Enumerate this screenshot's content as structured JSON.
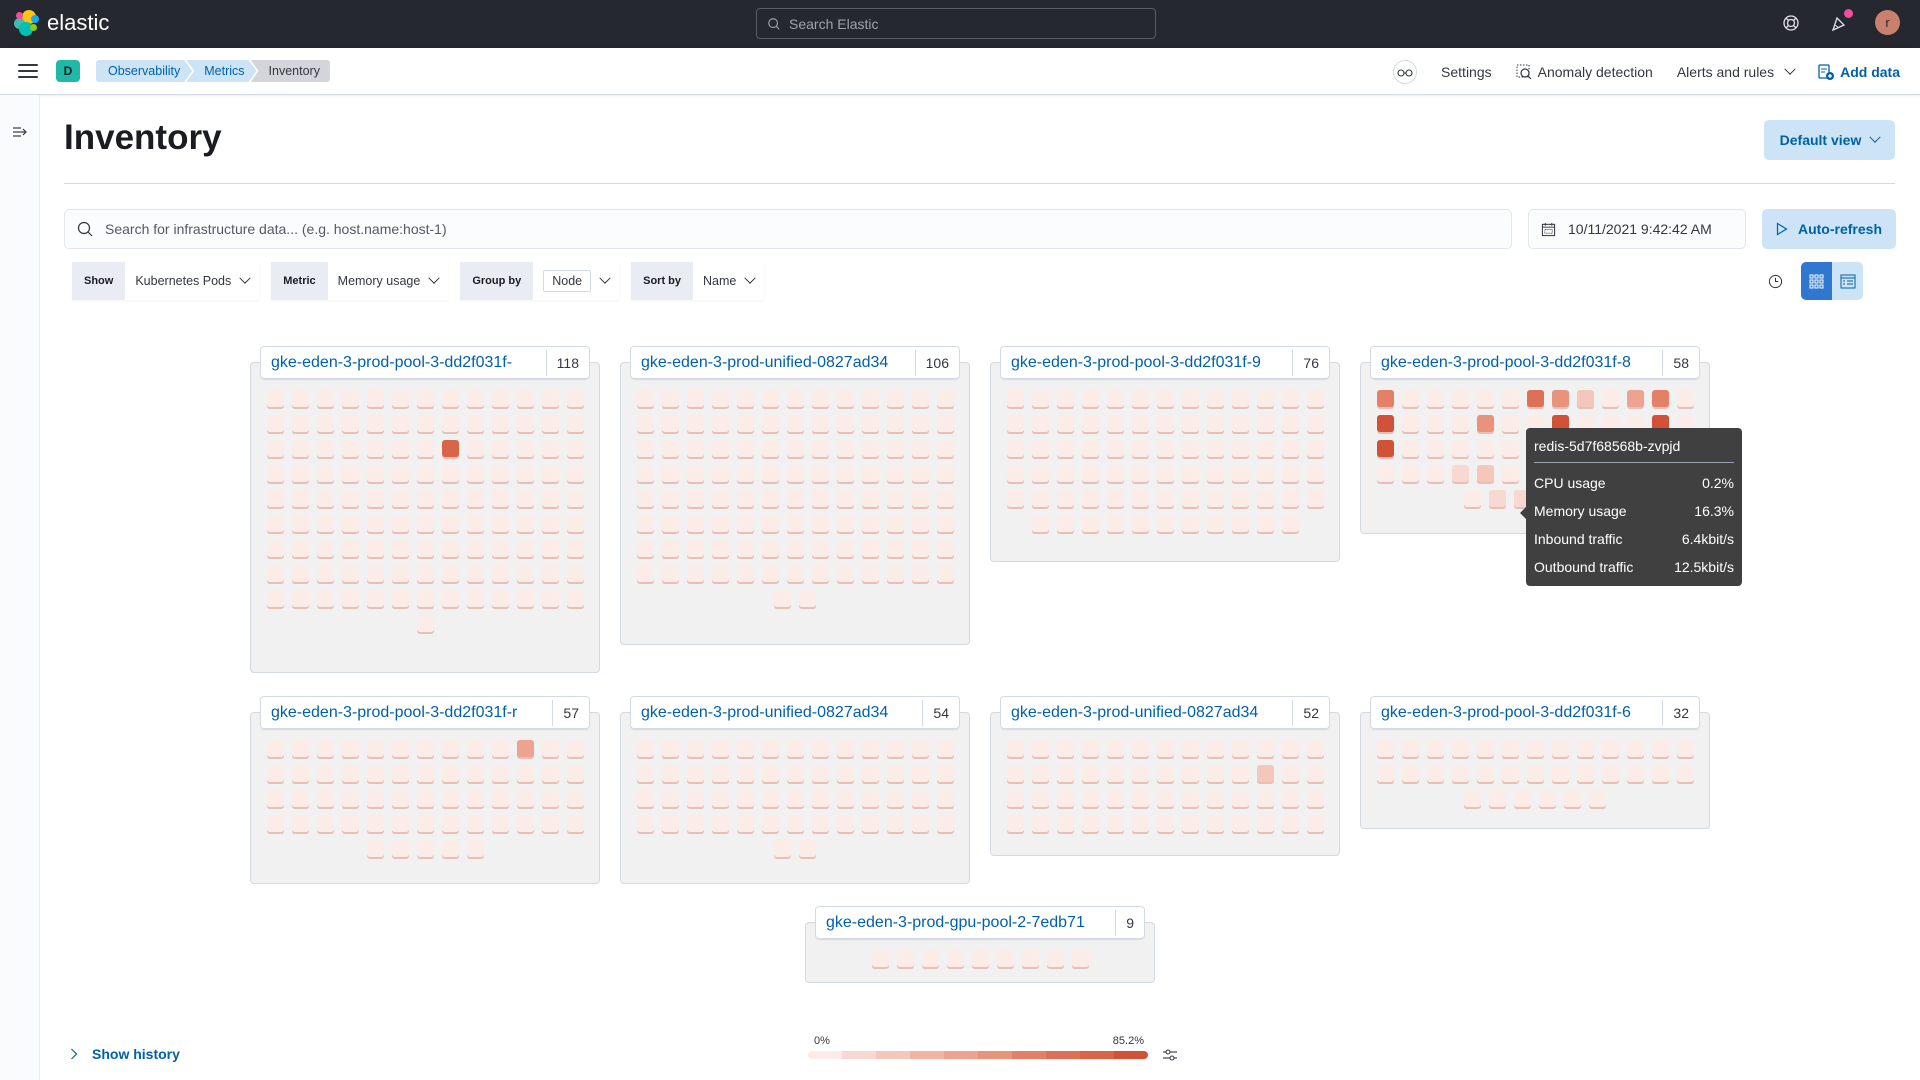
{
  "topbar": {
    "brand": "elastic",
    "search_placeholder": "Search Elastic",
    "avatar_initial": "r"
  },
  "subbar": {
    "space_initial": "D",
    "breadcrumbs": [
      "Observability",
      "Metrics",
      "Inventory"
    ],
    "actions": {
      "settings": "Settings",
      "anomaly": "Anomaly detection",
      "alerts": "Alerts and rules",
      "add_data": "Add data"
    }
  },
  "page": {
    "title": "Inventory",
    "default_view": "Default view",
    "search_placeholder": "Search for infrastructure data... (e.g. host.name:host-1)",
    "date": "10/11/2021 9:42:42 AM",
    "auto_refresh": "Auto-refresh"
  },
  "toolbar": {
    "show": {
      "label": "Show",
      "value": "Kubernetes Pods"
    },
    "metric": {
      "label": "Metric",
      "value": "Memory usage"
    },
    "group_by": {
      "label": "Group by",
      "value": "Node"
    },
    "sort_by": {
      "label": "Sort by",
      "value": "Name"
    }
  },
  "palette": [
    "#fcece8",
    "#f8d9d1",
    "#f5c7bb",
    "#f1b4a4",
    "#eea290",
    "#e9927c",
    "#e47f68",
    "#df7058",
    "#d96447",
    "#d15237"
  ],
  "groups": [
    {
      "name": "gke-eden-3-prod-pool-3-dd2f031f-",
      "count": 118,
      "highlights": {
        "33": 8
      }
    },
    {
      "name": "gke-eden-3-prod-unified-0827ad34",
      "count": 106,
      "highlights": {}
    },
    {
      "name": "gke-eden-3-prod-pool-3-dd2f031f-9",
      "count": 76,
      "highlights": {}
    },
    {
      "name": "gke-eden-3-prod-pool-3-dd2f031f-8",
      "count": 58,
      "highlights": {
        "0": 6,
        "6": 7,
        "7": 5,
        "8": 2,
        "10": 4,
        "11": 6,
        "13": 9,
        "17": 5,
        "20": 9,
        "24": 9,
        "26": 9,
        "42": 1,
        "43": 2,
        "53": 1,
        "54": 1
      }
    },
    {
      "name": "gke-eden-3-prod-pool-3-dd2f031f-r",
      "count": 57,
      "highlights": {
        "10": 4
      }
    },
    {
      "name": "gke-eden-3-prod-unified-0827ad34",
      "count": 54,
      "highlights": {}
    },
    {
      "name": "gke-eden-3-prod-unified-0827ad34",
      "count": 52,
      "highlights": {
        "23": 2
      }
    },
    {
      "name": "gke-eden-3-prod-pool-3-dd2f031f-6",
      "count": 32,
      "highlights": {}
    },
    {
      "name": "gke-eden-3-prod-gpu-pool-2-7edb71",
      "count": 9,
      "highlights": {}
    }
  ],
  "tooltip": {
    "title": "redis-5d7f68568b-zvpjd",
    "rows": [
      {
        "label": "CPU usage",
        "value": "0.2%"
      },
      {
        "label": "Memory usage",
        "value": "16.3%"
      },
      {
        "label": "Inbound traffic",
        "value": "6.4kbit/s"
      },
      {
        "label": "Outbound traffic",
        "value": "12.5kbit/s"
      }
    ]
  },
  "footer": {
    "show_history": "Show history",
    "legend_min": "0%",
    "legend_max": "85.2%"
  }
}
